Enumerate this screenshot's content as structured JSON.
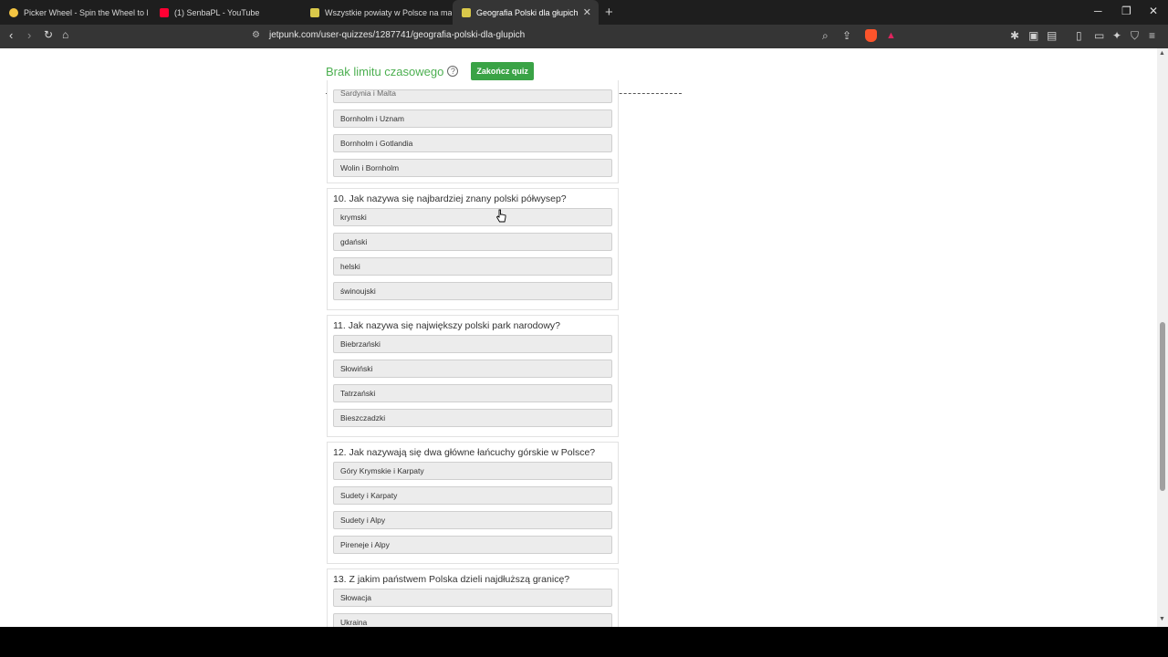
{
  "tabs": [
    {
      "title": "Picker Wheel - Spin the Wheel to De",
      "favicon_color": "#f4c542"
    },
    {
      "title": "(1) SenbaPL - YouTube",
      "favicon_color": "#ff0033"
    },
    {
      "title": "Wszystkie powiaty w Polsce na mapie",
      "favicon_color": "#d9c84a"
    },
    {
      "title": "Geografia Polski dla głupich",
      "favicon_color": "#d9c84a"
    }
  ],
  "url": "jetpunk.com/user-quizzes/1287741/geografia-polski-dla-glupich",
  "header": {
    "timer_label": "Brak limitu czasowego",
    "help_glyph": "?",
    "finish_label": "Zakończ quiz"
  },
  "partial_question": {
    "options": [
      "Sardynia i Malta",
      "Bornholm i Uznam",
      "Bornholm i Gotlandia",
      "Wolin i Bornholm"
    ]
  },
  "questions": [
    {
      "title": "10. Jak nazywa się najbardziej znany polski półwysep?",
      "options": [
        "krymski",
        "gdański",
        "helski",
        "świnoujski"
      ]
    },
    {
      "title": "11. Jak nazywa się największy polski park narodowy?",
      "options": [
        "Biebrzański",
        "Słowiński",
        "Tatrzański",
        "Bieszczadzki"
      ]
    },
    {
      "title": "12. Jak nazywają się dwa główne łańcuchy górskie w Polsce?",
      "options": [
        "Góry Krymskie i Karpaty",
        "Sudety i Karpaty",
        "Sudety i Alpy",
        "Pireneje i Alpy"
      ]
    },
    {
      "title": "13. Z jakim państwem Polska dzieli najdłuższą granicę?",
      "options": [
        "Słowacja",
        "Ukraina"
      ]
    }
  ]
}
